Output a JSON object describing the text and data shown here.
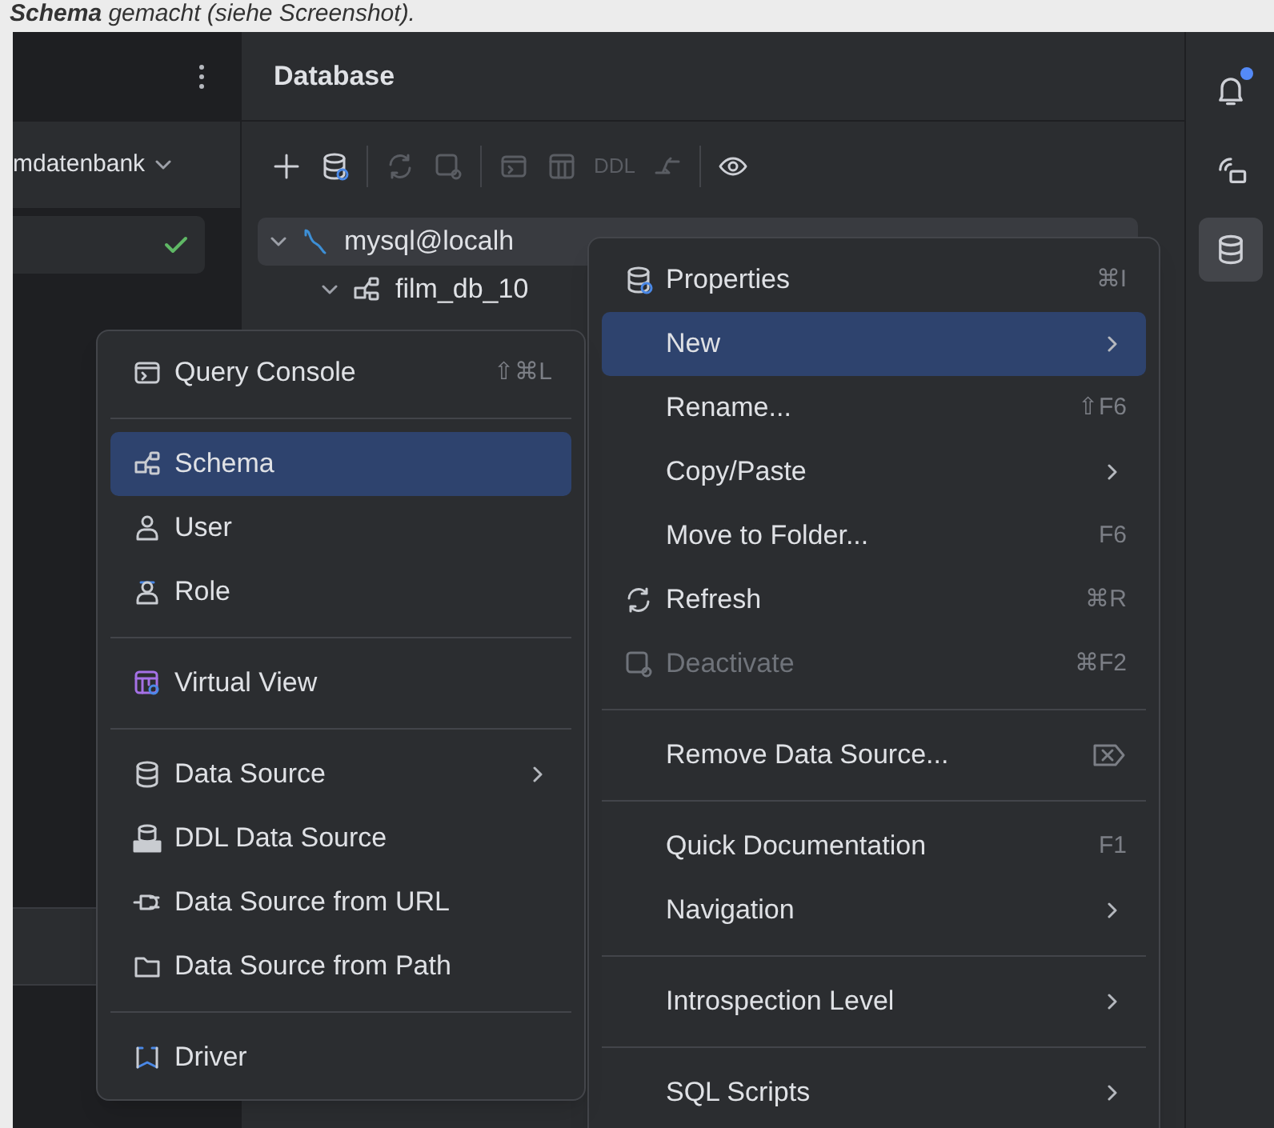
{
  "caption": "**Schema** gemacht (siehe Screenshot).",
  "left_panel": {
    "selector": "mdatenbank"
  },
  "database_panel": {
    "title": "Database",
    "toolbar": [
      {
        "disabled": false
      },
      {
        "disabled": false
      },
      {
        "disabled": true
      },
      {
        "disabled": true
      },
      {
        "disabled": true
      },
      {
        "disabled": true
      },
      {
        "label": "DDL",
        "disabled": true
      },
      {
        "disabled": true
      },
      {
        "disabled": false
      }
    ],
    "tree": [
      {
        "label": "mysql@localh",
        "expanded": true,
        "children": [
          {
            "label": "film_db_10",
            "expanded": true
          }
        ]
      }
    ]
  },
  "right_toolbar": [
    {
      "selected": false,
      "badge": true
    },
    {
      "selected": false,
      "badge": false
    },
    {
      "selected": true,
      "badge": false
    }
  ],
  "context_menu": {
    "items": [
      {
        "kind": "item",
        "label": "Properties",
        "shortcut": "⌘I",
        "submenu": false,
        "selected": false,
        "disabled": false
      },
      {
        "kind": "item",
        "label": "New",
        "submenu": true,
        "selected": true,
        "disabled": false
      },
      {
        "kind": "item",
        "label": "Rename...",
        "shortcut": "⇧F6",
        "submenu": false,
        "selected": false,
        "disabled": false
      },
      {
        "kind": "item",
        "label": "Copy/Paste",
        "submenu": true,
        "selected": false,
        "disabled": false
      },
      {
        "kind": "item",
        "label": "Move to Folder...",
        "shortcut": "F6",
        "submenu": false,
        "selected": false,
        "disabled": false
      },
      {
        "kind": "item",
        "label": "Refresh",
        "shortcut": "⌘R",
        "submenu": false,
        "selected": false,
        "disabled": false
      },
      {
        "kind": "item",
        "label": "Deactivate",
        "shortcut": "⌘F2",
        "submenu": false,
        "selected": false,
        "disabled": true
      },
      {
        "kind": "separator"
      },
      {
        "kind": "item",
        "label": "Remove Data Source...",
        "submenu": false,
        "selected": false,
        "disabled": false
      },
      {
        "kind": "separator"
      },
      {
        "kind": "item",
        "label": "Quick Documentation",
        "shortcut": "F1",
        "submenu": false,
        "selected": false,
        "disabled": false
      },
      {
        "kind": "item",
        "label": "Navigation",
        "submenu": true,
        "selected": false,
        "disabled": false
      },
      {
        "kind": "separator"
      },
      {
        "kind": "item",
        "label": "Introspection Level",
        "submenu": true,
        "selected": false,
        "disabled": false
      },
      {
        "kind": "separator"
      },
      {
        "kind": "item",
        "label": "SQL Scripts",
        "submenu": true,
        "selected": false,
        "disabled": false
      }
    ]
  },
  "new_submenu": {
    "items": [
      {
        "kind": "item",
        "label": "Query Console",
        "shortcut": "⇧⌘L",
        "submenu": false,
        "selected": false
      },
      {
        "kind": "separator"
      },
      {
        "kind": "item",
        "label": "Schema",
        "submenu": false,
        "selected": true
      },
      {
        "kind": "item",
        "label": "User",
        "submenu": false,
        "selected": false
      },
      {
        "kind": "item",
        "label": "Role",
        "submenu": false,
        "selected": false
      },
      {
        "kind": "separator"
      },
      {
        "kind": "item",
        "label": "Virtual View",
        "submenu": false,
        "selected": false
      },
      {
        "kind": "separator"
      },
      {
        "kind": "item",
        "label": "Data Source",
        "submenu": true,
        "selected": false
      },
      {
        "kind": "item",
        "label": "DDL Data Source",
        "submenu": false,
        "selected": false
      },
      {
        "kind": "item",
        "label": "Data Source from URL",
        "submenu": false,
        "selected": false
      },
      {
        "kind": "item",
        "label": "Data Source from Path",
        "submenu": false,
        "selected": false
      },
      {
        "kind": "separator"
      },
      {
        "kind": "item",
        "label": "Driver",
        "submenu": false,
        "selected": false
      }
    ]
  }
}
